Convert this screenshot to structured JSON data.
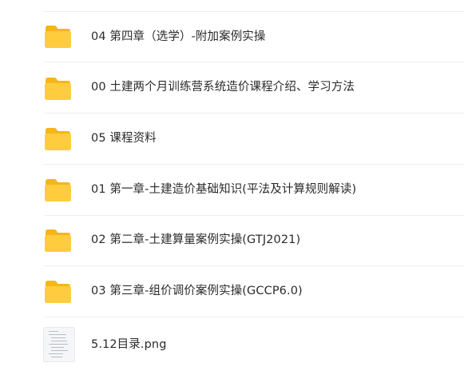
{
  "files": [
    {
      "name": "04 第四章（选学）-附加案例实操",
      "type": "folder",
      "icon": "folder-icon"
    },
    {
      "name": "00 土建两个月训练营系统造价课程介绍、学习方法",
      "type": "folder",
      "icon": "folder-icon"
    },
    {
      "name": "05 课程资料",
      "type": "folder",
      "icon": "folder-icon"
    },
    {
      "name": "01 第一章-土建造价基础知识(平法及计算规则解读)",
      "type": "folder",
      "icon": "folder-icon"
    },
    {
      "name": "02 第二章-土建算量案例实操(GTJ2021)",
      "type": "folder",
      "icon": "folder-icon"
    },
    {
      "name": "03 第三章-组价调价案例实操(GCCP6.0)",
      "type": "folder",
      "icon": "folder-icon"
    },
    {
      "name": "5.12目录.png",
      "type": "image",
      "icon": "image-thumbnail-icon"
    }
  ],
  "colors": {
    "folder_front": "#ffcc3d",
    "folder_back": "#f5b51b",
    "text": "#2b2b2b",
    "divider": "#eeeff2"
  }
}
